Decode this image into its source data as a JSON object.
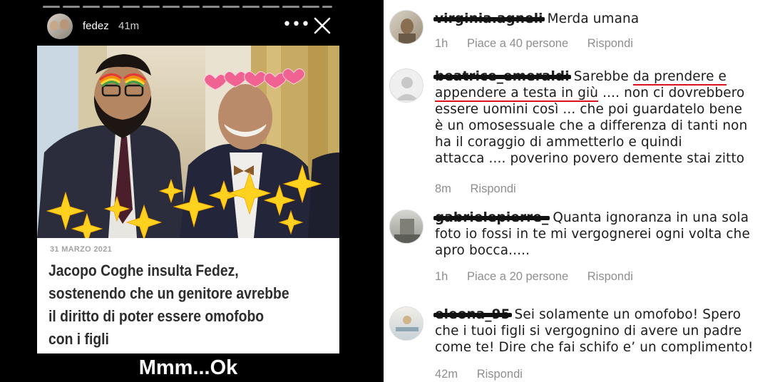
{
  "story": {
    "username": "fedez",
    "time": "41m",
    "more_glyph": "•••",
    "close_icon": "close-icon",
    "article": {
      "date": "31 MARZO 2021",
      "title": "Jacopo Coghe insulta Fedez,\nsostenendo che un genitore avrebbe\nil diritto di poter essere omofobo\ncon i figli"
    },
    "caption": "Mmm...Ok"
  },
  "comments": [
    {
      "username": "virginia.agneli",
      "parts": [
        {
          "text": " Merda umana"
        }
      ],
      "time": "1h",
      "likes": "Piace a 40 persone",
      "reply": "Rispondi"
    },
    {
      "username": "beatrice_emeraldi",
      "parts": [
        {
          "text": " Sarebbe "
        },
        {
          "text": "da prendere e\nappendere a testa in giù",
          "underline": true
        },
        {
          "text": " .... non ci dovrebbero\nessere uomini così ... che poi guardatelo bene\nè un omosessuale che a differenza di tanti non\nha il coraggio di ammetterlo e quindi\nattacca .... poverino povero demente stai zitto"
        }
      ],
      "time": "8m",
      "likes": "",
      "reply": "Rispondi"
    },
    {
      "username": "gabrielepierre_",
      "parts": [
        {
          "text": " Quanta ignoranza in una sola\nfoto io fossi in te mi vergognerei ogni volta che\napro bocca....."
        }
      ],
      "time": "1h",
      "likes": "Piace a 20 persone",
      "reply": "Rispondi"
    },
    {
      "username": "eleona_95",
      "parts": [
        {
          "text": " Sei solamente un omofobo! Spero\nche i tuoi figli si vergognino di avere un padre\ncome te! Dire che fai schifo e’ un complimento!"
        }
      ],
      "time": "42m",
      "likes": "",
      "reply": "Rispondi"
    }
  ]
}
